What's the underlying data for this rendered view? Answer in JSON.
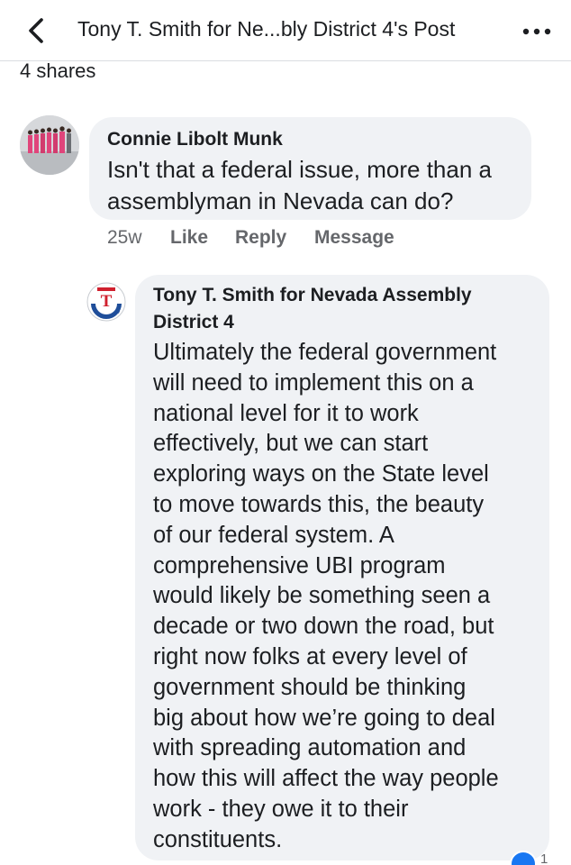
{
  "header": {
    "title": "Tony T. Smith for Ne...bly District 4's Post",
    "back_icon": "chevron-left-icon",
    "more_icon": "more-horizontal-icon"
  },
  "post": {
    "shares": "4 shares"
  },
  "comment1": {
    "author": "Connie Libolt Munk",
    "text": "Isn't that a federal issue, more than a assemblyman in Nevada can do?",
    "time": "25w",
    "like_label": "Like",
    "reply_label": "Reply",
    "message_label": "Message"
  },
  "reply1": {
    "author_line1": "Tony T. Smith for Nevada Assembly",
    "author_line2": "District 4",
    "lines": [
      "Ultimately the federal government",
      "will need to implement this on a",
      "national level for it to work",
      "effectively, but we can start",
      "exploring ways on the State level",
      "to move towards this, the beauty",
      "of our federal system. A",
      "comprehensive UBI program",
      "would likely be something seen a",
      "decade or two down the road, but",
      "right now folks at every level of",
      "government should be thinking",
      "big about how we’re going to deal",
      "with spreading automation and",
      "how this will affect the way people",
      "work - they owe it to their",
      "constituents."
    ],
    "reaction_count": "1"
  },
  "colors": {
    "bubble": "#f0f2f5",
    "secondary_text": "#65676b",
    "reaction_blue": "#1877f2",
    "logo_red": "#d0202e",
    "logo_blue": "#1f4e9a"
  }
}
